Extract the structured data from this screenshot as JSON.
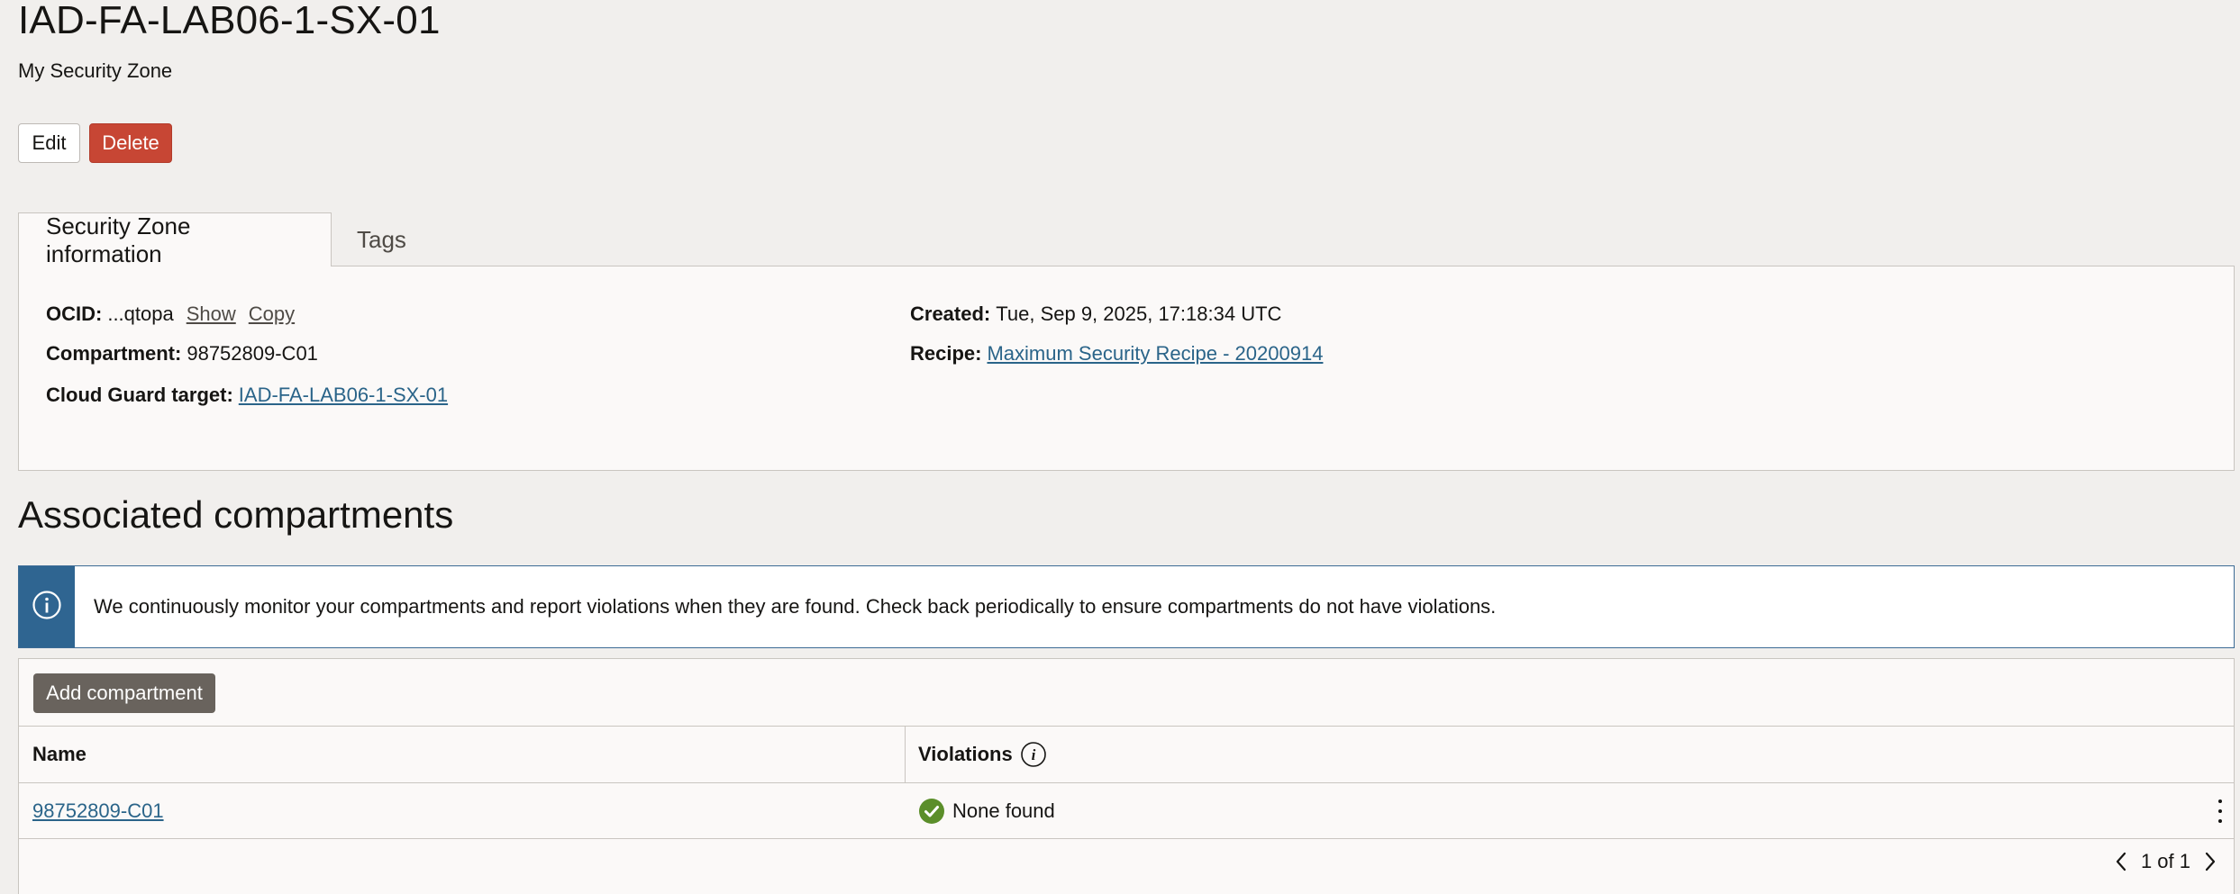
{
  "header": {
    "title": "IAD-FA-LAB06-1-SX-01",
    "subtitle": "My Security Zone"
  },
  "actions": {
    "edit_label": "Edit",
    "delete_label": "Delete"
  },
  "tabs": [
    {
      "label": "Security Zone information",
      "active": true
    },
    {
      "label": "Tags",
      "active": false
    }
  ],
  "details": {
    "ocid_label": "OCID:",
    "ocid_value": "...qtopa",
    "ocid_show": "Show",
    "ocid_copy": "Copy",
    "compartment_label": "Compartment:",
    "compartment_value": "98752809-C01",
    "cloud_guard_label": "Cloud Guard target:",
    "cloud_guard_value": "IAD-FA-LAB06-1-SX-01",
    "created_label": "Created:",
    "created_value": "Tue, Sep 9, 2025, 17:18:34 UTC",
    "recipe_label": "Recipe:",
    "recipe_value": "Maximum Security Recipe - 20200914"
  },
  "associated": {
    "title": "Associated compartments",
    "banner_text": "We continuously monitor your compartments and report violations when they are found. Check back periodically to ensure compartments do not have violations.",
    "add_button": "Add compartment",
    "columns": [
      "Name",
      "Violations"
    ],
    "rows": [
      {
        "name": "98752809-C01",
        "violations": "None found",
        "status": "ok"
      }
    ],
    "pagination": "1 of 1"
  },
  "colors": {
    "delete": "#c74634",
    "link": "#2a6489",
    "info": "#2f6591",
    "success": "#5b8e2a"
  },
  "icons": {
    "banner": "info-icon",
    "violations_help": "info-small-icon",
    "status_ok": "check-circle-icon",
    "row_menu": "kebab-menu-icon",
    "prev": "chevron-left-icon",
    "next": "chevron-right-icon"
  }
}
